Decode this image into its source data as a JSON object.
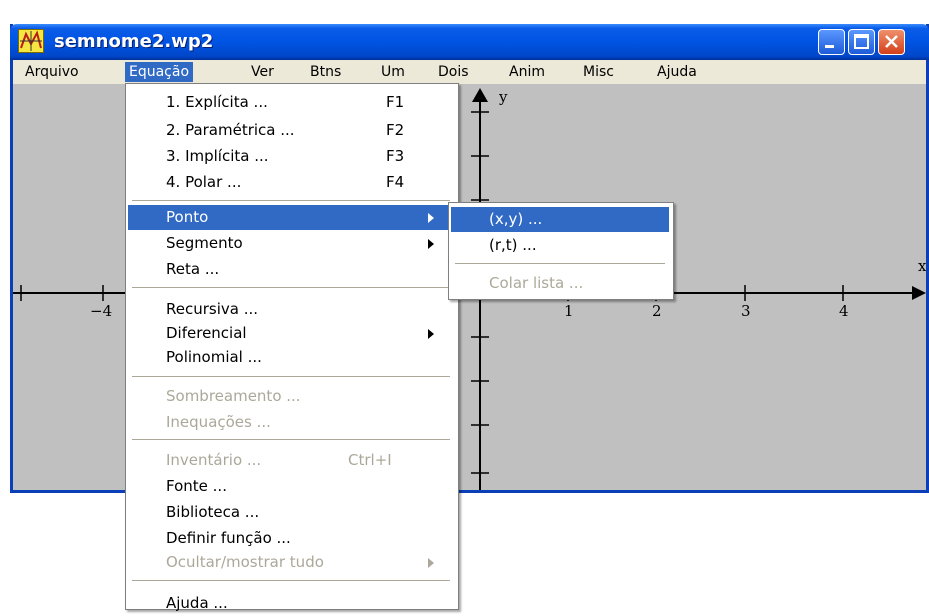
{
  "window": {
    "title": "semnome2.wp2",
    "icon": "graph-app-icon",
    "controls": [
      "minimize-icon",
      "maximize-icon",
      "close-icon"
    ]
  },
  "menubar": {
    "items": [
      "Arquivo",
      "Equação",
      "Ver",
      "Btns",
      "Um",
      "Dois",
      "Anim",
      "Misc",
      "Ajuda"
    ],
    "active": "Equação"
  },
  "equacao_menu": {
    "item_explicita": "1. Explícita ...",
    "sc_explicita": "F1",
    "item_parametrica": "2. Paramétrica ...",
    "sc_parametrica": "F2",
    "item_implicita": "3. Implícita ...",
    "sc_implicita": "F3",
    "item_polar": "4. Polar ...",
    "sc_polar": "F4",
    "item_ponto": "Ponto",
    "item_segmento": "Segmento",
    "item_reta": "Reta ...",
    "item_recursiva": "Recursiva ...",
    "item_diferencial": "Diferencial",
    "item_polinomial": "Polinomial ...",
    "item_sombreamento": "Sombreamento ...",
    "item_inequacoes": "Inequações ...",
    "item_inventario": "Inventário ...",
    "sc_inventario": "Ctrl+I",
    "item_fonte": "Fonte ...",
    "item_biblioteca": "Biblioteca ...",
    "item_definir_funcao": "Definir função ...",
    "item_ocultar_mostrar": "Ocultar/mostrar tudo",
    "item_ajuda": "Ajuda ..."
  },
  "ponto_submenu": {
    "item_xy": "(x,y) ...",
    "item_rt": "(r,t) ...",
    "item_colar_lista": "Colar lista ..."
  },
  "graph": {
    "x_axis_label": "x",
    "y_axis_label": "y",
    "x_tick_labels": [
      "−4",
      "1",
      "2",
      "3",
      "4"
    ],
    "background": "#c0c0c0"
  },
  "colors": {
    "titlebar": "#0054e3",
    "menu_highlight": "#316ac5",
    "disabled_text": "#aca899",
    "close_button": "#d2401a"
  }
}
